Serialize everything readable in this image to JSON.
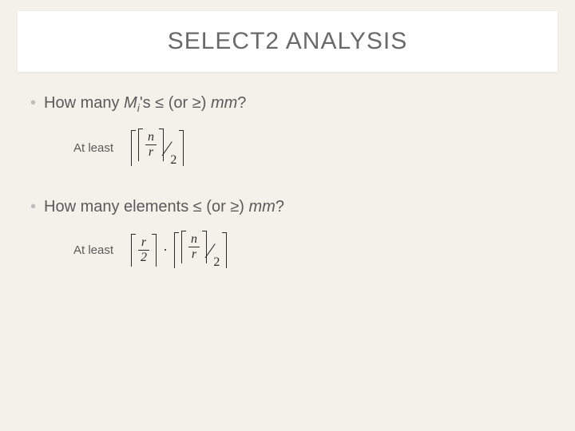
{
  "title": "SELECT2 ANALYSIS",
  "bullet1": {
    "prefix": "How many ",
    "M": "M",
    "sub": "i",
    "apos": "'s ",
    "le": "≤",
    "or": " (or ",
    "ge": "≥",
    "rest": ") ",
    "mm": "mm",
    "q": "?"
  },
  "atleast": "At least",
  "math": {
    "n": "n",
    "r": "r",
    "two": "2",
    "dot": "·"
  },
  "bullet2": {
    "prefix": "How many elements  ",
    "le": "≤",
    "or": " (or ",
    "ge": "≥",
    "rest": ") ",
    "mm": "mm",
    "q": "?"
  }
}
